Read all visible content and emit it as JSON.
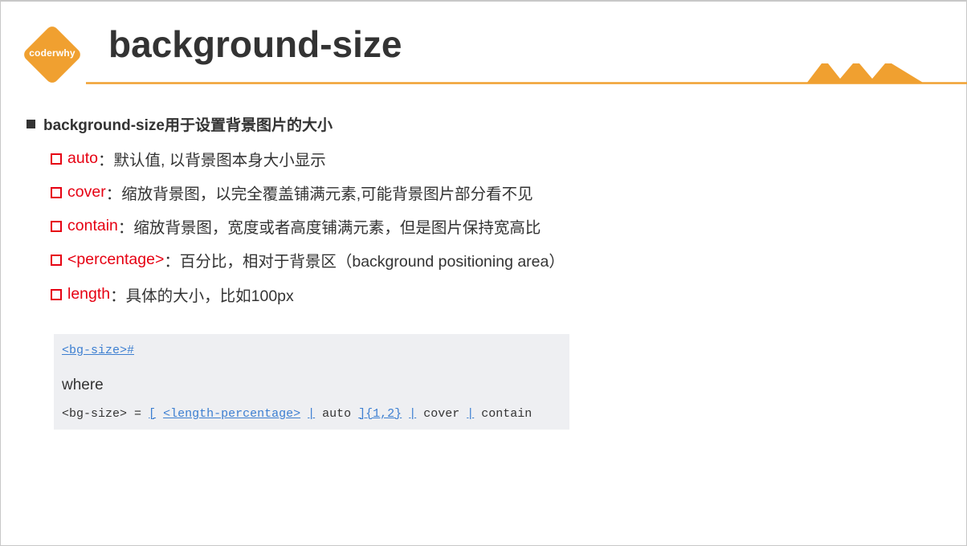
{
  "logo": {
    "text": "coderwhy"
  },
  "title": "background-size",
  "colors": {
    "accent": "#f0a030",
    "title": "#333333",
    "keyword": "#e60012",
    "link": "#3d7fd1",
    "panel_bg": "#eeeff2"
  },
  "bullet": {
    "text": "background-size用于设置背景图片的大小"
  },
  "items": [
    {
      "keyword": "auto",
      "desc": "：默认值, 以背景图本身大小显示"
    },
    {
      "keyword": "cover",
      "desc": "：缩放背景图，以完全覆盖铺满元素,可能背景图片部分看不见"
    },
    {
      "keyword": "contain",
      "desc": "：缩放背景图，宽度或者高度铺满元素，但是图片保持宽高比"
    },
    {
      "keyword": "<percentage>",
      "desc": "：百分比，相对于背景区（background positioning area）"
    },
    {
      "keyword": "length",
      "desc": "：具体的大小，比如100px"
    }
  ],
  "code": {
    "link": "<bg-size>#",
    "where": "where",
    "syntax": {
      "lhs": "<bg-size> = ",
      "open_bracket": "[",
      "length_percentage": "<length-percentage>",
      "bar1": "|",
      "auto": " auto ",
      "close_bracket": "]",
      "multiplier": "{1,2}",
      "bar2": "|",
      "cover": " cover ",
      "bar3": "|",
      "contain": " contain"
    }
  }
}
